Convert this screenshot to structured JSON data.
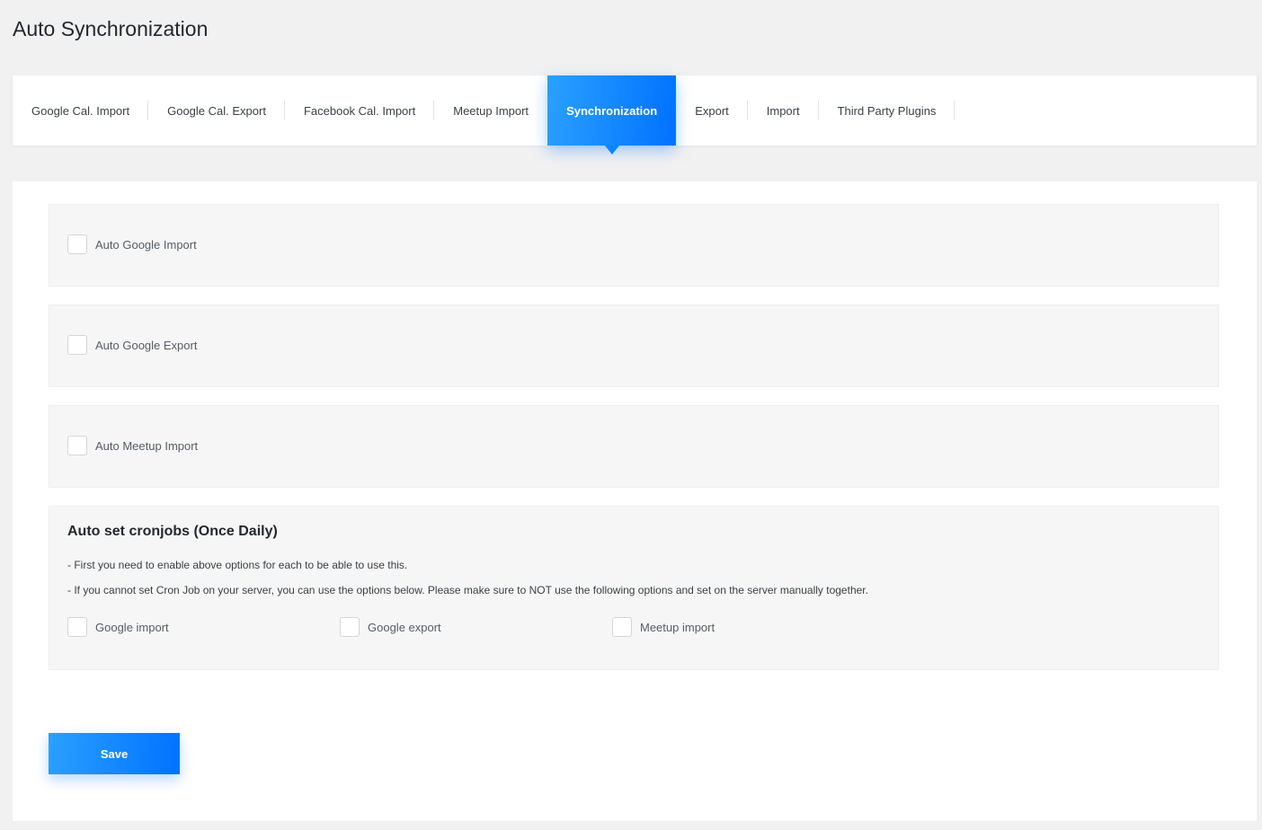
{
  "page": {
    "title": "Auto Synchronization"
  },
  "tabs": [
    {
      "label": "Google Cal. Import",
      "active": false
    },
    {
      "label": "Google Cal. Export",
      "active": false
    },
    {
      "label": "Facebook Cal. Import",
      "active": false
    },
    {
      "label": "Meetup Import",
      "active": false
    },
    {
      "label": "Synchronization",
      "active": true
    },
    {
      "label": "Export",
      "active": false
    },
    {
      "label": "Import",
      "active": false
    },
    {
      "label": "Third Party Plugins",
      "active": false
    }
  ],
  "options": {
    "auto_google_import": {
      "label": "Auto Google Import",
      "checked": false
    },
    "auto_google_export": {
      "label": "Auto Google Export",
      "checked": false
    },
    "auto_meetup_import": {
      "label": "Auto Meetup Import",
      "checked": false
    }
  },
  "cron": {
    "title": "Auto set cronjobs (Once Daily)",
    "note_1": "- First you need to enable above options for each to be able to use this.",
    "note_2": "- If you cannot set Cron Job on your server, you can use the options below. Please make sure to NOT use the following options and set on the server manually together.",
    "google_import": {
      "label": "Google import",
      "checked": false
    },
    "google_export": {
      "label": "Google export",
      "checked": false
    },
    "meetup_import": {
      "label": "Meetup import",
      "checked": false
    }
  },
  "actions": {
    "save_label": "Save"
  },
  "colors": {
    "accent_start": "#2aa0ff",
    "accent_end": "#0072ff",
    "background": "#f1f1f1"
  }
}
